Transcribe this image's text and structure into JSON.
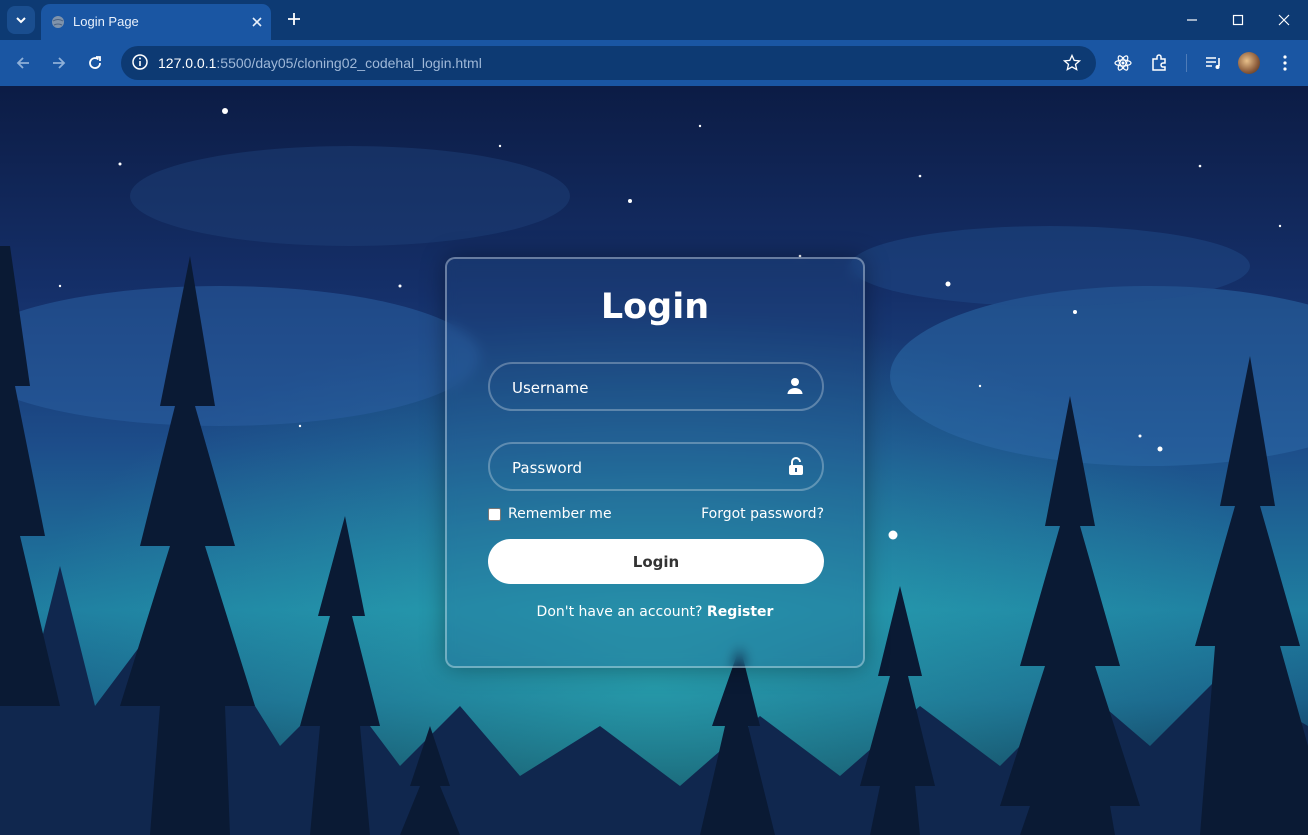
{
  "browser": {
    "tab_title": "Login Page",
    "url_host": "127.0.0.1",
    "url_rest": ":5500/day05/cloning02_codehal_login.html"
  },
  "login": {
    "title": "Login",
    "username_placeholder": "Username",
    "password_placeholder": "Password",
    "remember_label": "Remember me",
    "forgot_label": "Forgot password?",
    "button_label": "Login",
    "register_prompt": "Don't have an account?",
    "register_link": "Register"
  },
  "colors": {
    "tabbar": "#0d3a73",
    "toolbar": "#1a56a3",
    "button_bg": "#ffffff",
    "text": "#ffffff"
  },
  "icons": [
    "tab-search-icon",
    "globe-icon",
    "close-icon",
    "plus-icon",
    "minimize-icon",
    "maximize-icon",
    "back-icon",
    "forward-icon",
    "reload-icon",
    "site-info-icon",
    "star-icon",
    "react-devtools-icon",
    "extensions-icon",
    "media-queue-icon",
    "user-icon",
    "lock-icon"
  ]
}
